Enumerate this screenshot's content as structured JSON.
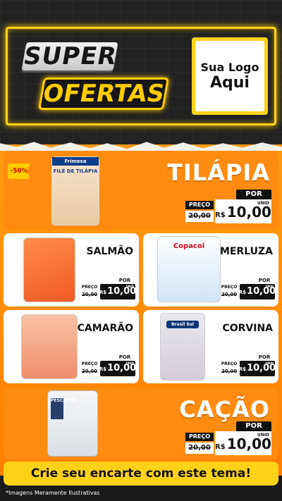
{
  "header": {
    "title_top": "SUPER",
    "title_bottom": "OFERTAS",
    "logo_line1": "Sua Logo",
    "logo_line2": "Aqui",
    "accent_color": "#ffd21a"
  },
  "featured_top": {
    "badge": "-50%",
    "name": "TILÁPIA",
    "brand": "Frimesa",
    "package_label": "FILÉ DE TILÁPIA",
    "price_por": "POR",
    "price_label": "PREÇO",
    "old_price": "20,00",
    "currency": "R$",
    "new_price": "10,00",
    "unit": "UNID"
  },
  "cards": [
    {
      "name": "SALMÃO",
      "brand": "",
      "por": "POR",
      "preco": "PREÇO",
      "old": "20,00",
      "cur": "R$",
      "val": "10,00",
      "unit": "UNID"
    },
    {
      "name": "MERLUZA",
      "brand": "Copacol",
      "por": "POR",
      "preco": "PREÇO",
      "old": "20,00",
      "cur": "R$",
      "val": "10,00",
      "unit": "UNID"
    },
    {
      "name": "CAMARÃO",
      "brand": "",
      "por": "POR",
      "preco": "PREÇO",
      "old": "20,00",
      "cur": "R$",
      "val": "10,00",
      "unit": "UNID"
    },
    {
      "name": "CORVINA",
      "brand": "Brasil Sul",
      "por": "POR",
      "preco": "PREÇO",
      "old": "20,00",
      "cur": "R$",
      "val": "10,00",
      "unit": "UNID"
    }
  ],
  "featured_bottom": {
    "name": "CAÇÃO",
    "brand": "PESCADOS",
    "price_por": "POR",
    "price_label": "PREÇO",
    "old_price": "20,00",
    "currency": "R$",
    "new_price": "10,00",
    "unit": "UNID"
  },
  "cta": "Crie seu encarte com este tema!",
  "footer": "*Imagens Meramente Ilustrativas"
}
